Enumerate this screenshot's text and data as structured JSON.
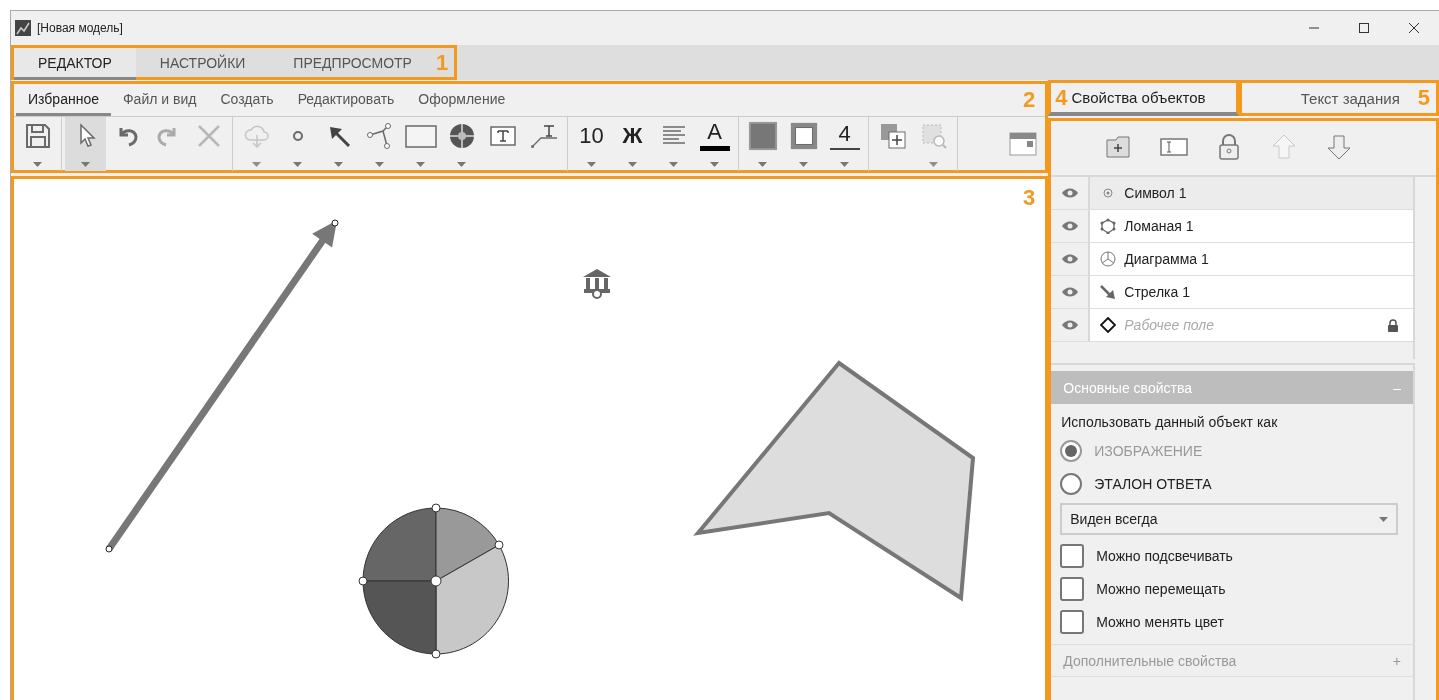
{
  "window": {
    "title": "[Новая модель]"
  },
  "main_tabs": {
    "marker": "1",
    "tabs": [
      {
        "label": "РЕДАКТОР",
        "selected": true
      },
      {
        "label": "НАСТРОЙКИ",
        "selected": false
      },
      {
        "label": "ПРЕДПРОСМОТР",
        "selected": false
      }
    ]
  },
  "ribbon": {
    "marker": "2",
    "tabs": [
      {
        "label": "Избранное",
        "selected": true
      },
      {
        "label": "Файл и вид",
        "selected": false
      },
      {
        "label": "Создать",
        "selected": false
      },
      {
        "label": "Редактировать",
        "selected": false
      },
      {
        "label": "Оформление",
        "selected": false
      }
    ],
    "tool_groups": [
      [
        {
          "dropdown": true,
          "selected": false,
          "disabled": false
        }
      ],
      [
        {
          "dropdown": true,
          "selected": true,
          "disabled": false
        },
        {
          "dropdown": false,
          "selected": false,
          "disabled": false
        },
        {
          "dropdown": false,
          "selected": false,
          "disabled": true
        },
        {
          "dropdown": false,
          "selected": false,
          "disabled": true
        }
      ],
      [
        {
          "dropdown": true,
          "selected": false,
          "disabled": true
        },
        {
          "dropdown": true,
          "selected": false,
          "disabled": false
        },
        {
          "dropdown": true,
          "selected": false,
          "disabled": false
        },
        {
          "dropdown": true,
          "selected": false,
          "disabled": false
        },
        {
          "dropdown": true,
          "selected": false,
          "disabled": false
        },
        {
          "dropdown": true,
          "selected": false,
          "disabled": false
        },
        {
          "dropdown": false,
          "selected": false,
          "disabled": false
        },
        {
          "dropdown": false,
          "selected": false,
          "disabled": false
        }
      ],
      [
        {
          "label": "10",
          "dropdown": true,
          "selected": false,
          "disabled": false
        },
        {
          "label": "Ж",
          "dropdown": true,
          "selected": false,
          "disabled": false
        },
        {
          "dropdown": true,
          "selected": false,
          "disabled": false
        },
        {
          "label": "A",
          "dropdown": true,
          "selected": false,
          "disabled": false
        }
      ],
      [
        {
          "dropdown": true,
          "selected": false,
          "disabled": false
        },
        {
          "dropdown": true,
          "selected": false,
          "disabled": false
        },
        {
          "label": "4",
          "dropdown": true,
          "selected": false,
          "disabled": false
        }
      ],
      [
        {
          "dropdown": false,
          "selected": false,
          "disabled": false
        },
        {
          "dropdown": true,
          "selected": false,
          "disabled": true
        }
      ]
    ]
  },
  "canvas": {
    "marker": "3"
  },
  "side_panel": {
    "tabs": [
      {
        "label": "Свойства объектов",
        "selected": true,
        "marker": "4"
      },
      {
        "label": "Текст задания",
        "selected": false,
        "marker": "5"
      }
    ],
    "object_tools": [
      {
        "disabled": false
      },
      {
        "disabled": false
      },
      {
        "disabled": false
      },
      {
        "disabled": true
      },
      {
        "disabled": false
      }
    ],
    "objects": [
      {
        "name": "Символ 1",
        "kind": "symbol",
        "visible": true,
        "selected": true,
        "locked": false
      },
      {
        "name": "Ломаная 1",
        "kind": "polyline",
        "visible": true,
        "selected": false,
        "locked": false
      },
      {
        "name": "Диаграмма 1",
        "kind": "diagram",
        "visible": true,
        "selected": false,
        "locked": false
      },
      {
        "name": "Стрелка 1",
        "kind": "arrow",
        "visible": true,
        "selected": false,
        "locked": false
      },
      {
        "name": "Рабочее поле",
        "kind": "field",
        "visible": true,
        "selected": false,
        "locked": true
      }
    ],
    "sections": [
      {
        "title": "Основные свойства",
        "toggle": "–",
        "expanded": true
      },
      {
        "title": "Дополнительные свойства",
        "toggle": "+",
        "expanded": false
      }
    ],
    "use_as_label": "Использовать данный объект как",
    "use_as": [
      {
        "label": "ИЗОБРАЖЕНИЕ",
        "selected": true,
        "disabled": true
      },
      {
        "label": "ЭТАЛОН ОТВЕТА",
        "selected": false,
        "disabled": false
      }
    ],
    "visibility": {
      "value": "Виден всегда"
    },
    "options": [
      {
        "label": "Можно подсвечивать",
        "checked": false
      },
      {
        "label": "Можно перемещать",
        "checked": false
      },
      {
        "label": "Можно менять цвет",
        "checked": false
      }
    ]
  }
}
